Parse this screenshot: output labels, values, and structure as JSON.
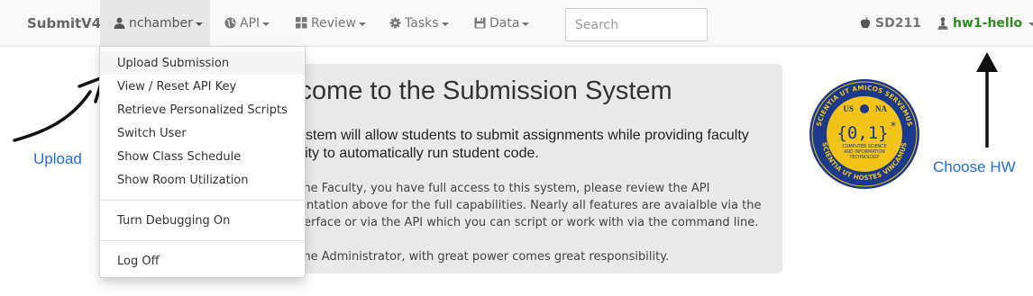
{
  "navbar": {
    "brand": "SubmitV4",
    "user_menu": {
      "icon": "user-icon",
      "label": "nchamber"
    },
    "api_menu": {
      "icon": "globe-icon",
      "label": "API"
    },
    "review_menu": {
      "icon": "grid-icon",
      "label": "Review"
    },
    "tasks_menu": {
      "icon": "gear-icon",
      "label": "Tasks"
    },
    "data_menu": {
      "icon": "database-icon",
      "label": "Data"
    },
    "search": {
      "placeholder": "Search",
      "value": ""
    },
    "section": {
      "icon": "apple-icon",
      "label": "SD211"
    },
    "assignment": {
      "icon": "chess-pawn-icon",
      "label": "hw1-hello",
      "color": "#2f8a1f"
    }
  },
  "dropdown": {
    "items": [
      "Upload Submission",
      "View / Reset API Key",
      "Retrieve Personalized Scripts",
      "Switch User",
      "Show Class Schedule",
      "Show Room Utilization",
      "Turn Debugging On",
      "Log Off"
    ],
    "active_item": "Upload Submission"
  },
  "welcome": {
    "title": "lcome to the Submission System",
    "lead_line1": "ystem will allow students to submit assignments while providing faculty",
    "lead_line2": "ility to automatically run student code.",
    "faculty_line1": "me Faculty, you have full access to this system, please review the API",
    "faculty_line2": "entation above for the full capabilities. Nearly all features are avaialble via the",
    "faculty_line3": "terface or via the API which you can script or work with via the command line.",
    "admin_line": "me Administrator, with great power comes great responsibility."
  },
  "annotations": {
    "upload_label": "Upload",
    "choose_label": "Choose HW",
    "color": "#1f6fd6"
  },
  "logo": {
    "ring_top": "SCIENTIA UT AMICOS SERVEMUS",
    "ring_bottom": "SCIENTIA UT HOSTES VINCAMUS",
    "usna_left": "US",
    "usna_right": "NA",
    "symbol": "{0,1}",
    "star": "*",
    "dept_line1": "COMPUTER SCIENCE",
    "dept_line2": "AND INFORMATION",
    "dept_line3": "TECHNOLOGY",
    "ring_color": "#1c3a8c",
    "fill_color": "#f2c418"
  }
}
